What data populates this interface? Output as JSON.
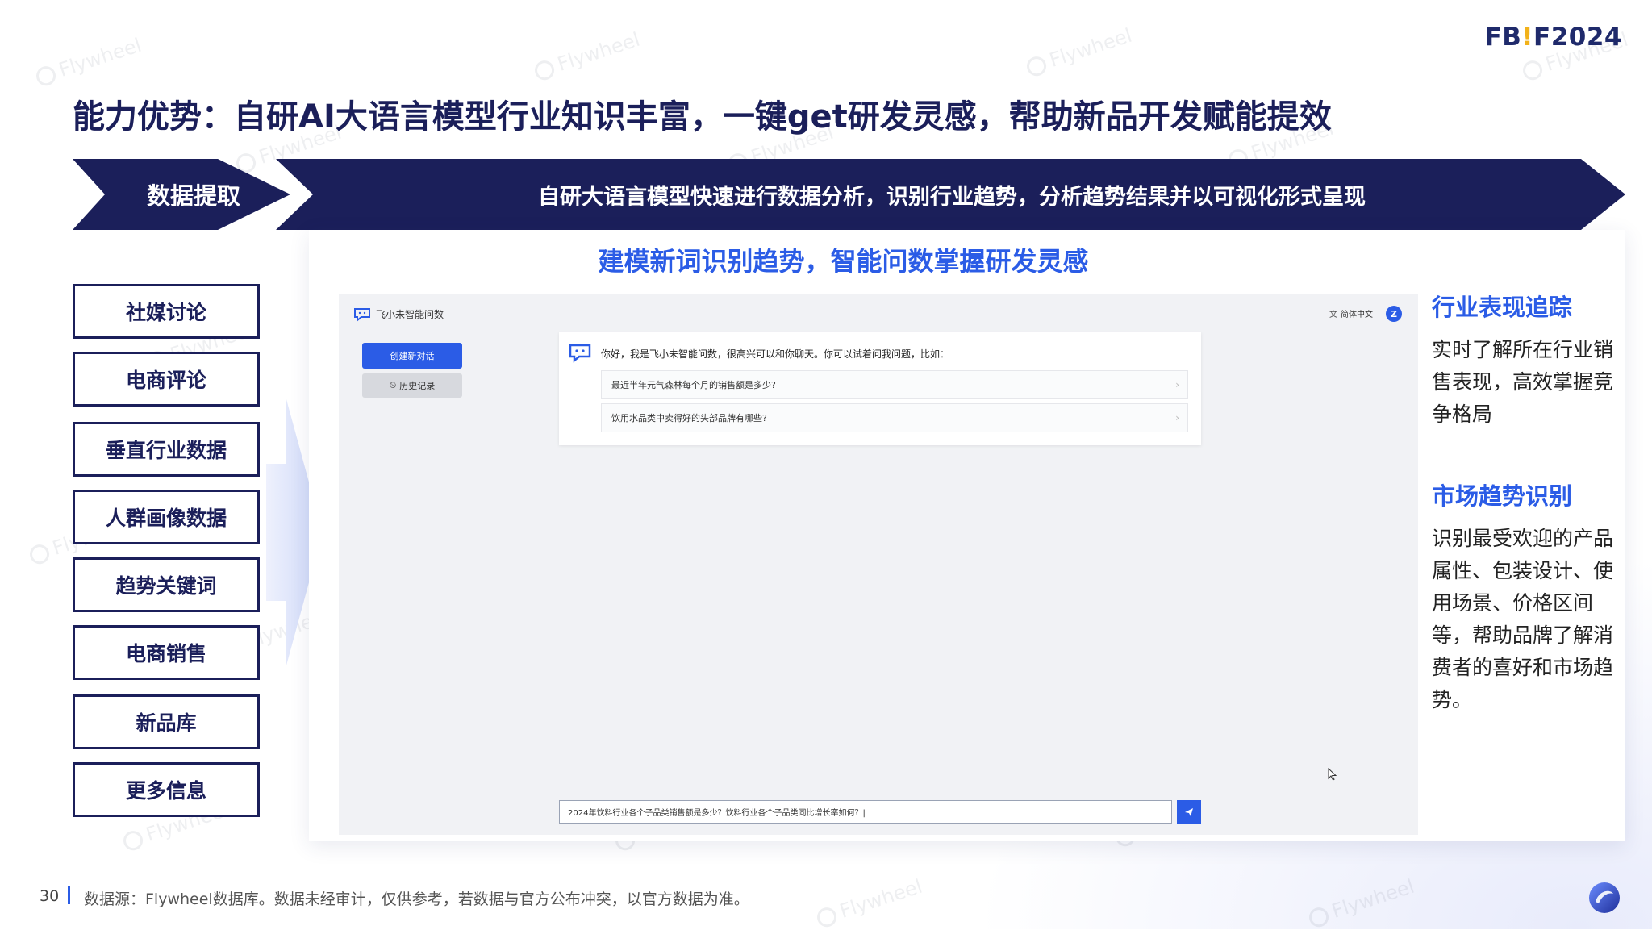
{
  "brand": {
    "prefix": "FB",
    "excl": "!",
    "suffix": "F2024"
  },
  "title": "能力优势：自研AI大语言模型行业知识丰富，一键get研发灵感，帮助新品开发赋能提效",
  "banner": {
    "left_label": "数据提取",
    "right_label": "自研大语言模型快速进行数据分析，识别行业趋势，分析趋势结果并以可视化形式呈现",
    "color": "#1b1f5a"
  },
  "sources": [
    "社媒讨论",
    "电商评论",
    "垂直行业数据",
    "人群画像数据",
    "趋势关键词",
    "电商销售",
    "新品库",
    "更多信息"
  ],
  "subtitle": "建模新词识别趋势，智能问数掌握研发灵感",
  "app": {
    "name": "飞小未智能问数",
    "language": "简体中文",
    "user_initial": "Z",
    "new_chat": "创建新对话",
    "history": "历史记录",
    "greeting": "你好，我是飞小未智能问数，很高兴可以和你聊天。你可以试着问我问题，比如：",
    "suggestions": [
      "最近半年元气森林每个月的销售额是多少?",
      "饮用水品类中卖得好的头部品牌有哪些?"
    ],
    "input_value": "2024年饮料行业各个子品类销售额是多少？饮料行业各个子品类同比增长率如何？|",
    "accent": "#2b5ce6"
  },
  "features": [
    {
      "title": "行业表现追踪",
      "desc": "实时了解所在行业销售表现，高效掌握竞争格局"
    },
    {
      "title": "市场趋势识别",
      "desc": "识别最受欢迎的产品属性、包装设计、使用场景、价格区间等，帮助品牌了解消费者的喜好和市场趋势。"
    }
  ],
  "footer": {
    "page": "30",
    "note": "数据源：Flywheel数据库。数据未经审计，仅供参考，若数据与官方公布冲突，以官方数据为准。"
  },
  "watermark": "Flywheel"
}
